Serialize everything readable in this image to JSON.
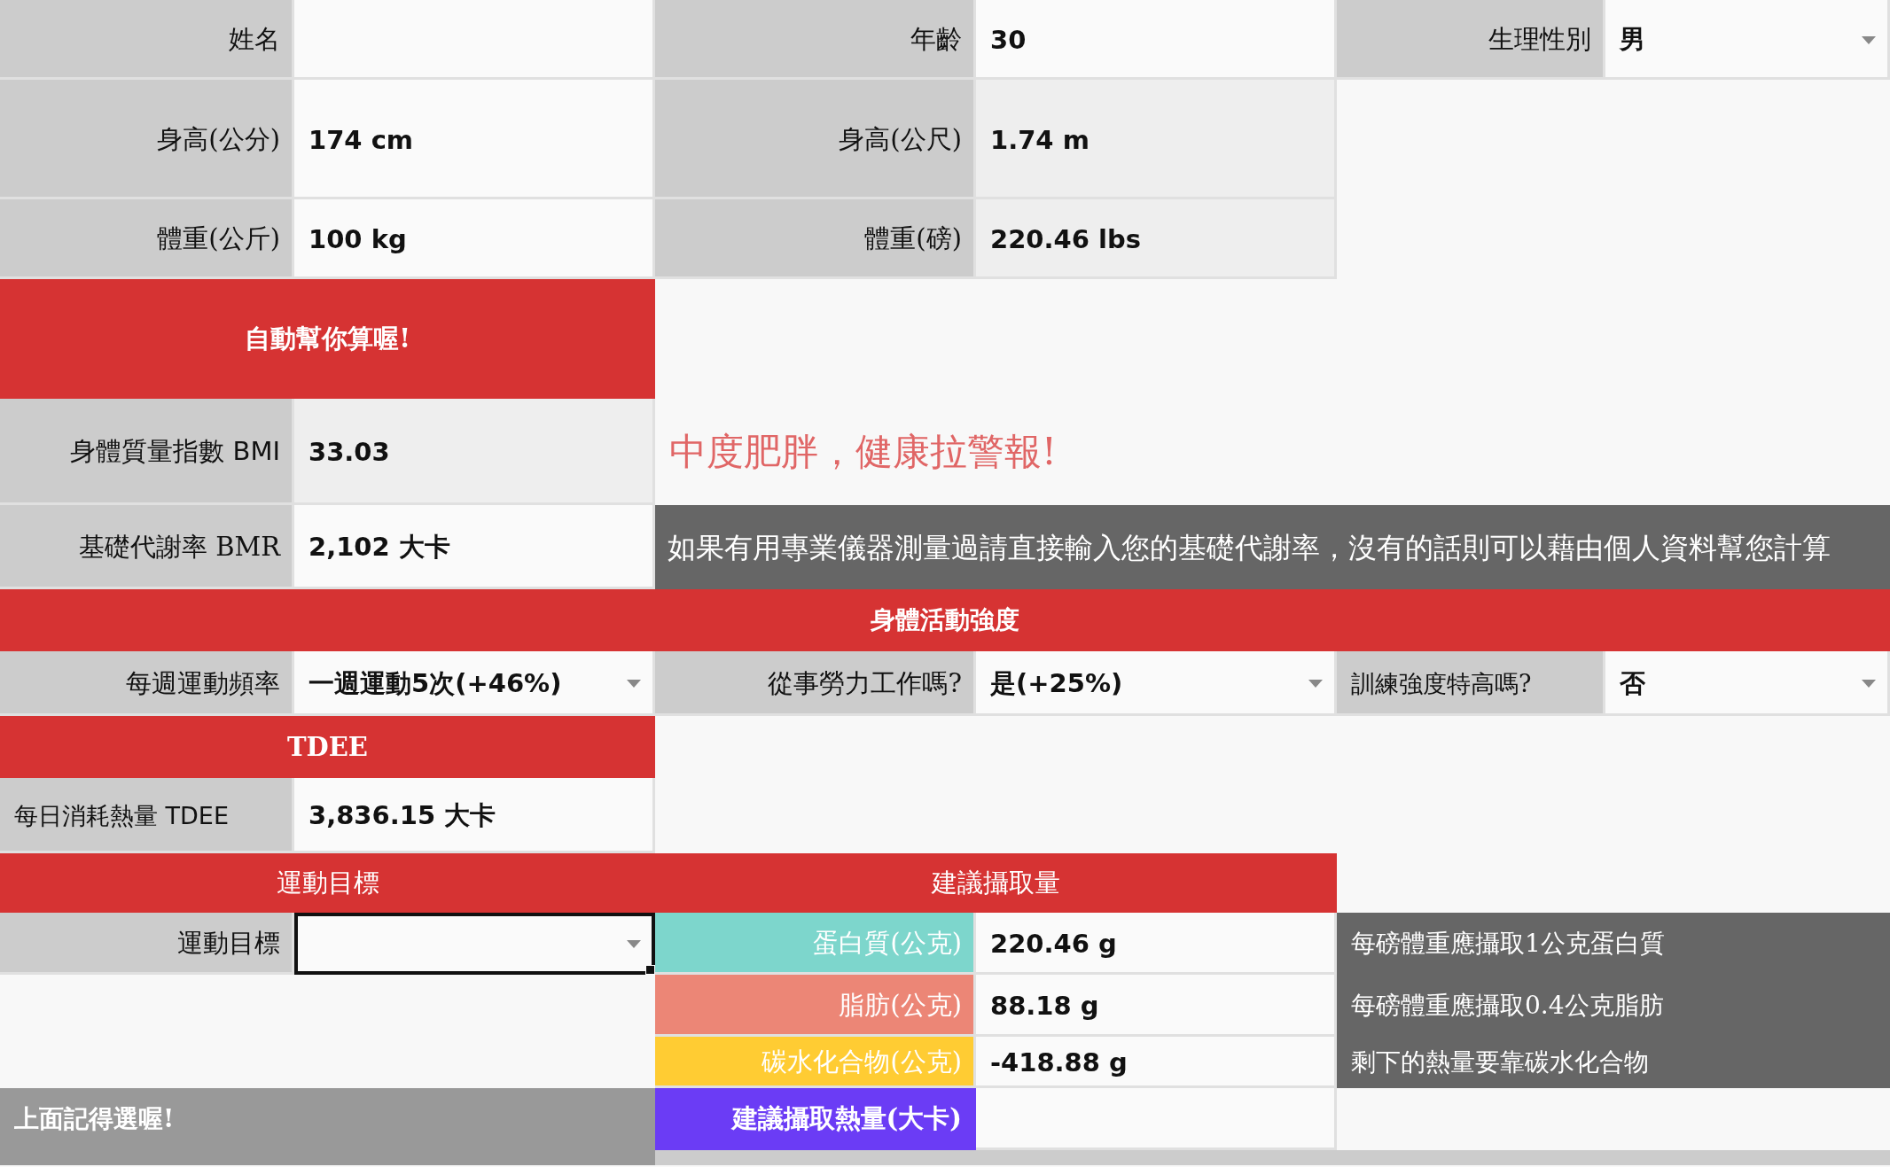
{
  "personal": {
    "name_label": "姓名",
    "age_label": "年齡",
    "age": "30",
    "sex_label": "生理性別",
    "sex": "男",
    "height_cm_label": "身高(公分)",
    "height_cm": "174 cm",
    "height_m_label": "身高(公尺)",
    "height_m": "1.74 m",
    "weight_kg_label": "體重(公斤)",
    "weight_kg": "100 kg",
    "weight_lb_label": "體重(磅)",
    "weight_lb": "220.46 lbs"
  },
  "auto_banner": "自動幫你算喔!",
  "bmi": {
    "label": "身體質量指數 BMI",
    "value": "33.03",
    "verdict": "中度肥胖，健康拉警報!"
  },
  "bmr": {
    "label": "基礎代謝率 BMR",
    "value": "2,102 大卡",
    "note": "如果有用專業儀器測量過請直接輸入您的基礎代謝率，沒有的話則可以藉由個人資料幫您計算"
  },
  "activity": {
    "header": "身體活動強度",
    "frequency_label": "每週運動頻率",
    "frequency": "一週運動5次(+46%)",
    "labor_label": "從事勞力工作嗎?",
    "labor": "是(+25%)",
    "intense_label": "訓練強度特高嗎?",
    "intense": "否"
  },
  "tdee": {
    "header": "TDEE",
    "label": "每日消耗熱量 TDEE",
    "value": "3,836.15 大卡"
  },
  "goal": {
    "header": "運動目標",
    "label": "運動目標",
    "selected": true
  },
  "intake": {
    "header": "建議攝取量",
    "macros": [
      {
        "label": "蛋白質(公克)",
        "value": "220.46 g",
        "note": "每磅體重應攝取1公克蛋白質",
        "color": "#7dd6cc"
      },
      {
        "label": "脂肪(公克)",
        "value": "88.18 g",
        "note": "每磅體重應攝取0.4公克脂肪",
        "color": "#ec8676"
      },
      {
        "label": "碳水化合物(公克)",
        "value": "-418.88 g",
        "note": "剩下的熱量要靠碳水化合物",
        "color": "#ffcc33"
      }
    ],
    "total": {
      "label": "建議攝取熱量(大卡)",
      "color": "#6b3cf5"
    }
  },
  "reminder": "上面記得選喔!"
}
